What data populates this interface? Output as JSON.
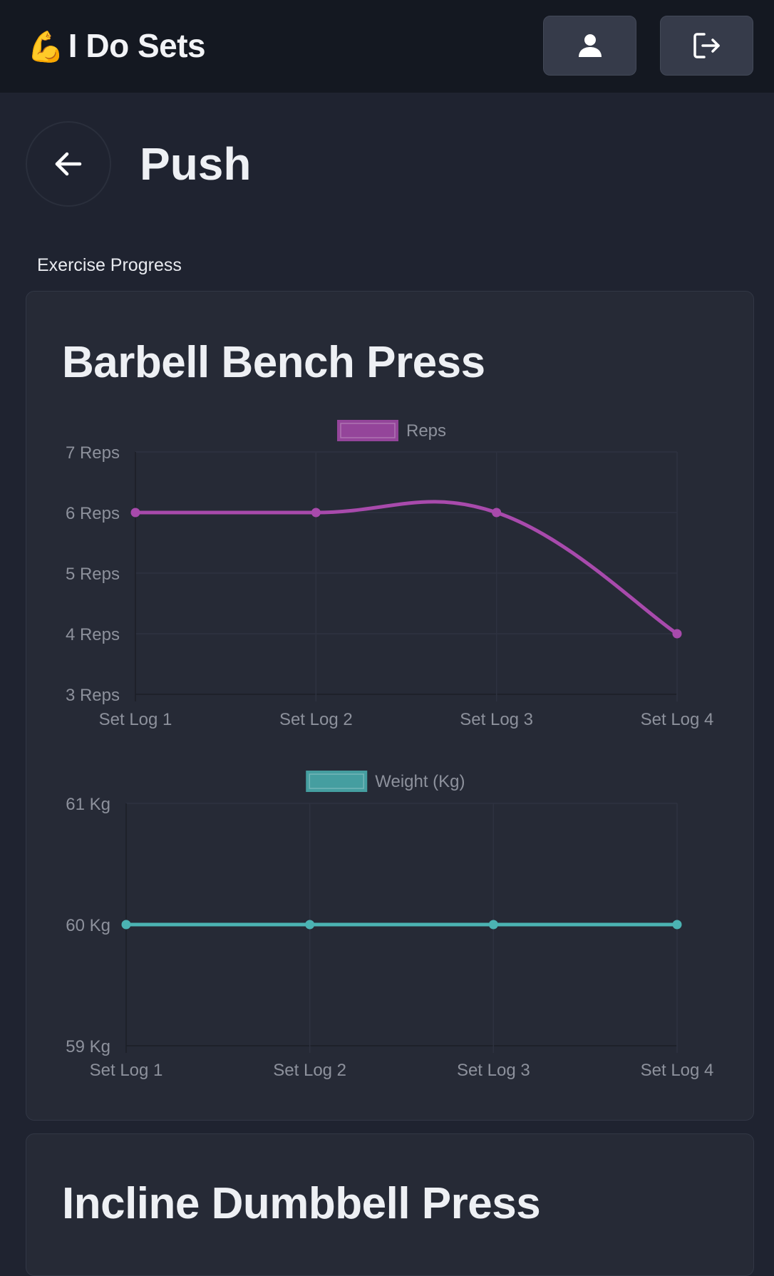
{
  "header": {
    "brand_emoji": "💪",
    "brand_name": "I Do Sets",
    "profile_icon": "user-icon",
    "logout_icon": "logout-icon"
  },
  "page": {
    "title": "Push",
    "back_icon": "arrow-left-icon",
    "section_label": "Exercise Progress"
  },
  "colors": {
    "reps": "#a84aac",
    "weight": "#4bb3b3",
    "background": "#1f2330",
    "card": "#262a36"
  },
  "exercises": [
    {
      "name": "Barbell Bench Press"
    },
    {
      "name": "Incline Dumbbell Press"
    }
  ],
  "chart_data": [
    {
      "type": "line",
      "legend": "top-center",
      "grid": true,
      "categories": [
        "Set Log 1",
        "Set Log 2",
        "Set Log 3",
        "Set Log 4"
      ],
      "series": [
        {
          "name": "Reps",
          "values": [
            6,
            6,
            6,
            4
          ],
          "color": "#a84aac"
        }
      ],
      "yticks": [
        "3 Reps",
        "4 Reps",
        "5 Reps",
        "6 Reps",
        "7 Reps"
      ],
      "ylim": [
        3,
        7
      ]
    },
    {
      "type": "line",
      "legend": "top-center",
      "grid": true,
      "categories": [
        "Set Log 1",
        "Set Log 2",
        "Set Log 3",
        "Set Log 4"
      ],
      "series": [
        {
          "name": "Weight (Kg)",
          "values": [
            60,
            60,
            60,
            60
          ],
          "color": "#4bb3b3"
        }
      ],
      "yticks": [
        "59 Kg",
        "60 Kg",
        "61 Kg"
      ],
      "ylim": [
        59,
        61
      ]
    }
  ]
}
